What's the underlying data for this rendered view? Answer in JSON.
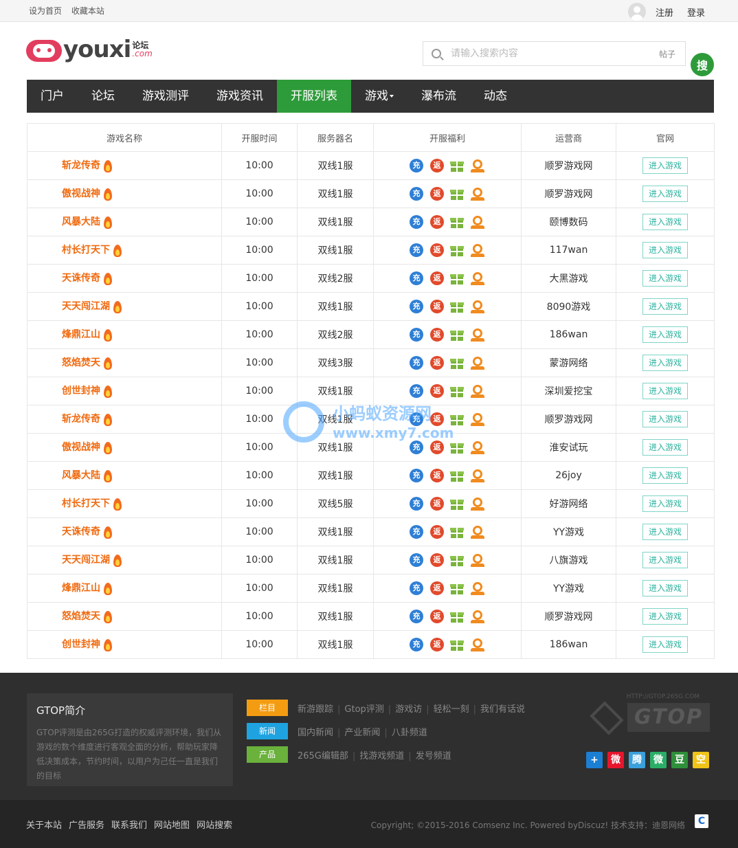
{
  "topbar": {
    "set_home": "设为首页",
    "bookmark": "收藏本站",
    "register": "注册",
    "login": "登录"
  },
  "logo": {
    "text": "youxi",
    "cn": "论坛",
    "com": ".com"
  },
  "search": {
    "placeholder": "请输入搜索内容",
    "scope": "帖子",
    "button": "搜"
  },
  "nav": [
    {
      "label": "门户",
      "active": false
    },
    {
      "label": "论坛",
      "active": false
    },
    {
      "label": "游戏测评",
      "active": false
    },
    {
      "label": "游戏资讯",
      "active": false
    },
    {
      "label": "开服列表",
      "active": true
    },
    {
      "label": "游戏",
      "active": false,
      "dropdown": true
    },
    {
      "label": "瀑布流",
      "active": false
    },
    {
      "label": "动态",
      "active": false
    }
  ],
  "table": {
    "headers": [
      "游戏名称",
      "开服时间",
      "服务器名",
      "开服福利",
      "运营商",
      "官网"
    ],
    "perk_labels": {
      "charge": "充",
      "rebate": "返"
    },
    "enter_label": "进入游戏",
    "rows": [
      {
        "name": "斩龙传奇",
        "time": "10:00",
        "server": "双线1服",
        "operator": "顺罗游戏网"
      },
      {
        "name": "傲视战神",
        "time": "10:00",
        "server": "双线1服",
        "operator": "顺罗游戏网"
      },
      {
        "name": "风暴大陆",
        "time": "10:00",
        "server": "双线1服",
        "operator": "颐博数码"
      },
      {
        "name": "村长打天下",
        "time": "10:00",
        "server": "双线1服",
        "operator": "117wan"
      },
      {
        "name": "天诛传奇",
        "time": "10:00",
        "server": "双线2服",
        "operator": "大黑游戏"
      },
      {
        "name": "天天闯江湖",
        "time": "10:00",
        "server": "双线1服",
        "operator": "8090游戏"
      },
      {
        "name": "烽鼎江山",
        "time": "10:00",
        "server": "双线2服",
        "operator": "186wan"
      },
      {
        "name": "怒焰焚天",
        "time": "10:00",
        "server": "双线3服",
        "operator": "蒙游网络"
      },
      {
        "name": "创世封神",
        "time": "10:00",
        "server": "双线1服",
        "operator": "深圳爱挖宝"
      },
      {
        "name": "斩龙传奇",
        "time": "10:00",
        "server": "双线1服",
        "operator": "顺罗游戏网"
      },
      {
        "name": "傲视战神",
        "time": "10:00",
        "server": "双线1服",
        "operator": "淮安试玩"
      },
      {
        "name": "风暴大陆",
        "time": "10:00",
        "server": "双线1服",
        "operator": "26joy"
      },
      {
        "name": "村长打天下",
        "time": "10:00",
        "server": "双线5服",
        "operator": "好游网络"
      },
      {
        "name": "天诛传奇",
        "time": "10:00",
        "server": "双线1服",
        "operator": "YY游戏"
      },
      {
        "name": "天天闯江湖",
        "time": "10:00",
        "server": "双线1服",
        "operator": "八旗游戏"
      },
      {
        "name": "烽鼎江山",
        "time": "10:00",
        "server": "双线1服",
        "operator": "YY游戏"
      },
      {
        "name": "怒焰焚天",
        "time": "10:00",
        "server": "双线1服",
        "operator": "顺罗游戏网"
      },
      {
        "name": "创世封神",
        "time": "10:00",
        "server": "双线1服",
        "operator": "186wan"
      }
    ]
  },
  "watermark": {
    "line1": "小蚂蚁资源网",
    "line2": "www.xmy7.com"
  },
  "footer": {
    "intro_title": "GTOP简介",
    "intro_text": "GTOP评测是由265G打造的权威评测环境，我们从游戏的数个维度进行客观全面的分析，帮助玩家降低决策成本，节约时间，以用户为己任一直是我们的目标",
    "rows": [
      {
        "tag": "栏目",
        "color": "#f39c12",
        "links": [
          "新游跟踪",
          "Gtop评测",
          "游戏访",
          "轻松一刻",
          "我们有话说"
        ]
      },
      {
        "tag": "新闻",
        "color": "#1fa3e0",
        "links": [
          "国内新闻",
          "产业新闻",
          "八卦频道"
        ]
      },
      {
        "tag": "产品",
        "color": "#6ab23b",
        "links": [
          "265G编辑部",
          "找游戏频道",
          "发号频道"
        ]
      }
    ],
    "gtop_url": "HTTP://GTOP.265G.COM",
    "gtop_text": "GTOP",
    "shares": [
      {
        "icon": "plus-share-icon",
        "glyph": "+",
        "color": "#1b7fd3"
      },
      {
        "icon": "weibo-icon",
        "glyph": "微",
        "color": "#e6162d"
      },
      {
        "icon": "tencent-weibo-icon",
        "glyph": "腾",
        "color": "#3aa1dc"
      },
      {
        "icon": "wechat-icon",
        "glyph": "微",
        "color": "#2aae67"
      },
      {
        "icon": "douban-icon",
        "glyph": "豆",
        "color": "#2f8f3a"
      },
      {
        "icon": "qzone-icon",
        "glyph": "空",
        "color": "#f0c419"
      }
    ]
  },
  "bottom": {
    "links": [
      "关于本站",
      "广告服务",
      "联系我们",
      "网站地图",
      "网站搜索"
    ],
    "copyright": "Copyright; ©2015-2016  Comsenz Inc.  Powered byDiscuz!  技术支持：迪恩网络",
    "badge": "C"
  }
}
